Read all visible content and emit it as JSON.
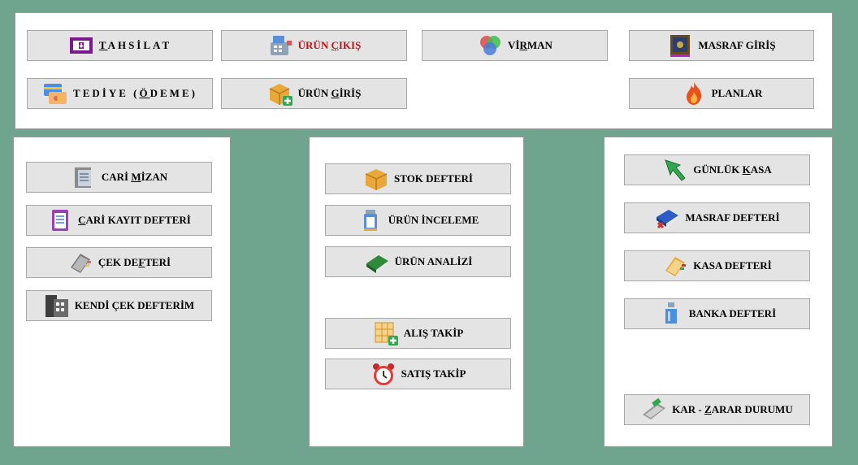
{
  "top_panel": {
    "buttons": [
      {
        "id": "tahsilat",
        "pre": "",
        "key": "T",
        "post": "AHSİLAT",
        "icon": "cash-register-icon"
      },
      {
        "id": "urun_cikis",
        "pre": "ÜRÜN ",
        "key": "Ç",
        "post": "IKIŞ",
        "icon": "cash-machine-icon"
      },
      {
        "id": "virman",
        "pre": "Vİ",
        "key": "R",
        "post": "MAN",
        "icon": "circles-icon"
      },
      {
        "id": "masraf_giris",
        "pre": "MASRAF GİRİŞ",
        "key": "",
        "post": "",
        "icon": "safe-icon"
      },
      {
        "id": "tediye",
        "pre": "TEDİYE (",
        "key": "Ö",
        "post": "DEME)",
        "icon": "cards-icon"
      },
      {
        "id": "urun_giris",
        "pre": "ÜRÜN ",
        "key": "G",
        "post": "İRİŞ",
        "icon": "box-add-icon"
      },
      {
        "id": "planlar",
        "pre": "PLANLAR",
        "key": "",
        "post": "",
        "icon": "flame-icon"
      }
    ]
  },
  "left_panel": {
    "buttons": [
      {
        "id": "cari_mizan",
        "pre": "CARİ ",
        "key": "M",
        "post": "İZAN",
        "icon": "ledger-gray-icon"
      },
      {
        "id": "cari_kayit",
        "pre": "",
        "key": "C",
        "post": "ARİ KAYIT DEFTERİ",
        "icon": "notepad-purple-icon"
      },
      {
        "id": "cek_defteri",
        "pre": "ÇEK DE",
        "key": "F",
        "post": "TERİ",
        "icon": "book-gray-icon"
      },
      {
        "id": "kendi_cek",
        "pre": "KENDİ ÇEK DEFTERİM",
        "key": "",
        "post": "",
        "icon": "register-dark-icon"
      }
    ]
  },
  "middle_panel": {
    "buttons": [
      {
        "id": "stok_defteri",
        "pre": "STOK DEFTERİ",
        "key": "",
        "post": "",
        "icon": "box-icon"
      },
      {
        "id": "urun_inceleme",
        "pre": "ÜRÜN İNCELEME",
        "key": "",
        "post": "",
        "icon": "bottle-icon"
      },
      {
        "id": "urun_analizi",
        "pre": "ÜRÜN ANALİZİ",
        "key": "",
        "post": "",
        "icon": "book-green-icon"
      },
      {
        "id": "alis_takip",
        "pre": "ALIŞ TAKİP",
        "key": "",
        "post": "",
        "icon": "grid-add-icon"
      },
      {
        "id": "satis_takip",
        "pre": "SATIŞ TAKİP",
        "key": "",
        "post": "",
        "icon": "alarm-clock-icon"
      }
    ]
  },
  "right_panel": {
    "buttons": [
      {
        "id": "gunluk_kasa",
        "pre": "GÜNLÜK ",
        "key": "K",
        "post": "ASA",
        "icon": "arrow-green-icon"
      },
      {
        "id": "masraf_defteri",
        "pre": "MASRAF DEFTERİ",
        "key": "",
        "post": "",
        "icon": "book-blue-icon"
      },
      {
        "id": "kasa_defteri",
        "pre": "KASA DEFTERİ",
        "key": "",
        "post": "",
        "icon": "book-yellow-icon"
      },
      {
        "id": "banka_defteri",
        "pre": "BANKA DEFTERİ",
        "key": "",
        "post": "",
        "icon": "bottle-blue-icon"
      },
      {
        "id": "kar_zarar",
        "pre": "KAR - ",
        "key": "Z",
        "post": "ARAR DURUMU",
        "icon": "card-reader-icon"
      }
    ]
  },
  "colors": {
    "background": "#6fa48f",
    "panel": "#ffffff",
    "button": "#e4e4e4",
    "accent_red": "#b8171a"
  }
}
